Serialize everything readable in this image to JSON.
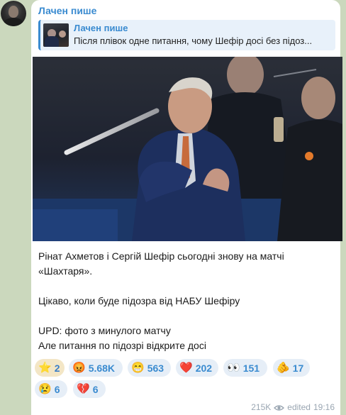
{
  "channel": {
    "sender_name": "Лачен пише"
  },
  "reply": {
    "title": "Лачен пише",
    "text": "Після плівок одне питання, чому Шефір досі без підоз..."
  },
  "post": {
    "lines": [
      "Рінат Ахметов і Сергій Шефір сьогодні знову на матчі",
      "«Шахтаря».",
      "",
      "Цікаво, коли буде підозра від НАБУ Шефіру",
      "",
      "UPD: фото з минулого матчу",
      "Але питання по підозрі відкрите досі"
    ]
  },
  "reactions": [
    {
      "icon": "star-icon",
      "emoji": "⭐",
      "count": "2",
      "chosen": true
    },
    {
      "icon": "angry-face-icon",
      "emoji": "😡",
      "count": "5.68K",
      "chosen": false
    },
    {
      "icon": "grimace-face-icon",
      "emoji": "😁",
      "count": "563",
      "chosen": false
    },
    {
      "icon": "heart-icon",
      "emoji": "❤️",
      "count": "202",
      "chosen": false
    },
    {
      "icon": "eyes-icon",
      "emoji": "👀",
      "count": "151",
      "chosen": false
    },
    {
      "icon": "pointing-hand-icon",
      "emoji": "🫵",
      "count": "17",
      "chosen": false
    },
    {
      "icon": "crying-face-icon",
      "emoji": "😢",
      "count": "6",
      "chosen": false
    },
    {
      "icon": "broken-heart-icon",
      "emoji": "💔",
      "count": "6",
      "chosen": false
    }
  ],
  "meta": {
    "views": "215K",
    "edited_label": "edited",
    "time": "19:16"
  },
  "colors": {
    "accent": "#3a8bd0",
    "background": "#cbd8bd",
    "bubble": "#ffffff"
  }
}
